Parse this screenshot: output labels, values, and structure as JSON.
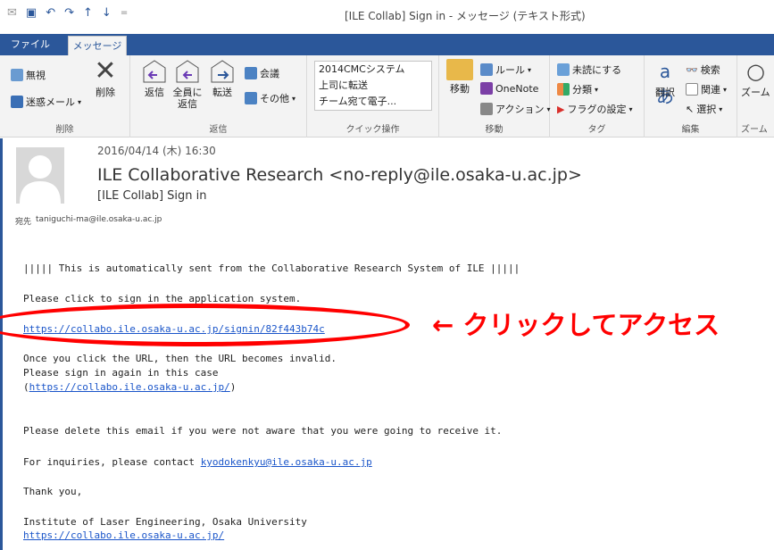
{
  "window": {
    "title": "[ILE Collab] Sign in - メッセージ (テキスト形式)"
  },
  "tabs": {
    "file": "ファイル",
    "message": "メッセージ"
  },
  "ribbon": {
    "delete_group": {
      "ignore": "無視",
      "junk": "迷惑メール",
      "delete": "削除",
      "label": "削除"
    },
    "respond_group": {
      "reply": "返信",
      "reply_all_1": "全員に",
      "reply_all_2": "返信",
      "forward": "転送",
      "meeting": "会議",
      "more": "その他",
      "label": "返信"
    },
    "quick_steps": {
      "items": [
        "2014CMCシステム",
        "上司に転送",
        "チーム宛て電子..."
      ],
      "label": "クイック操作"
    },
    "move_group": {
      "move": "移動",
      "rules": "ルール",
      "onenote": "OneNote",
      "actions": "アクション",
      "label": "移動"
    },
    "tags_group": {
      "unread": "未読にする",
      "categorize": "分類",
      "followup": "フラグの設定",
      "label": "タグ"
    },
    "editing_group": {
      "translate": "翻訳",
      "find": "検索",
      "related": "関連",
      "select": "選択",
      "label": "編集"
    },
    "zoom_group": {
      "zoom": "ズーム",
      "label": "ズーム"
    }
  },
  "header": {
    "date": "2016/04/14 (木) 16:30",
    "sender": "ILE Collaborative Research <no-reply@ile.osaka-u.ac.jp>",
    "subject": "[ILE Collab] Sign in",
    "to_label": "宛先",
    "to": "taniguchi-ma@ile.osaka-u.ac.jp"
  },
  "body": {
    "line1": "||||| This is automatically sent from the Collaborative Research System of ILE |||||",
    "line2": "Please click to sign in the application system.",
    "link1": "https://collabo.ile.osaka-u.ac.jp/signin/82f443b74c",
    "line3": "Once you click the URL, then the URL becomes invalid.",
    "line4": "Please sign in again in this case",
    "paren_open": "(",
    "link2": "https://collabo.ile.osaka-u.ac.jp/",
    "paren_close": ")",
    "line5": "Please delete this email if you were not aware that you were going to receive it.",
    "line6_prefix": "For inquiries, please contact ",
    "email": "kyodokenkyu@ile.osaka-u.ac.jp",
    "line7": "Thank you,",
    "line8": "Institute of Laser Engineering, Osaka University",
    "link3": "https://collabo.ile.osaka-u.ac.jp/"
  },
  "annotation": {
    "text": "←  クリックしてアクセス",
    "color": "#ff0000"
  },
  "colors": {
    "accent": "#2b579a",
    "link": "#1a55c9"
  }
}
